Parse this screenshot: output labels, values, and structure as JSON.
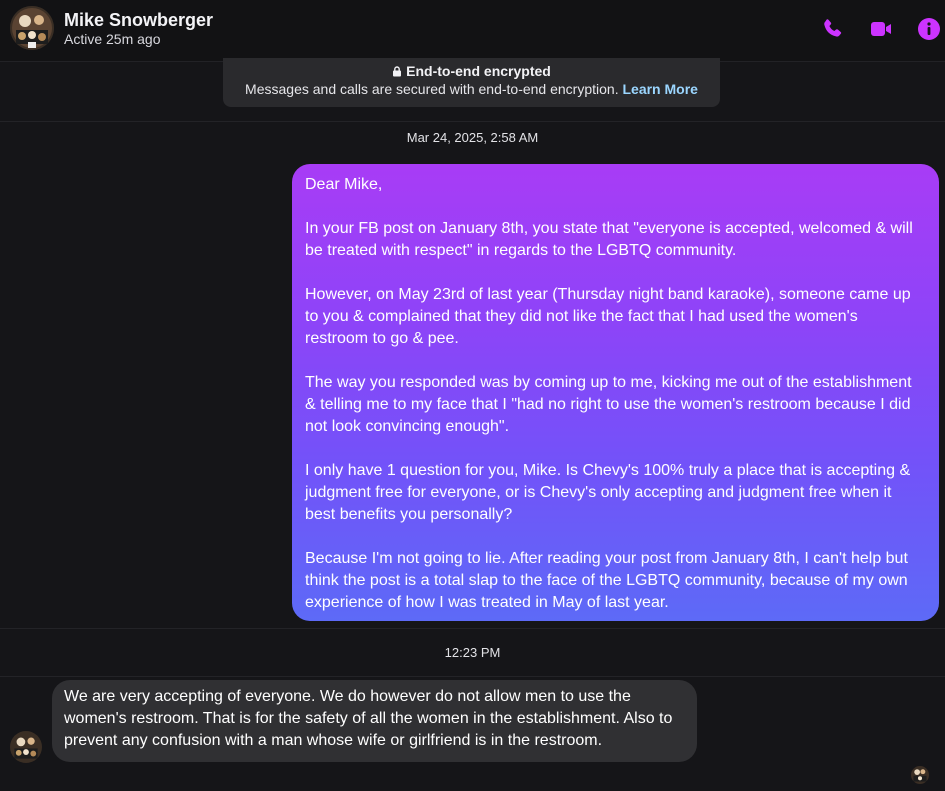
{
  "header": {
    "contact_name": "Mike Snowberger",
    "status": "Active 25m ago",
    "avatar_icon": "profile-photo",
    "actions": [
      {
        "name": "phone-icon"
      },
      {
        "name": "video-camera-icon"
      },
      {
        "name": "info-icon"
      }
    ],
    "accent_color": "#cc33ff"
  },
  "encryption": {
    "title": "End-to-end encrypted",
    "description": "Messages and calls are secured with end-to-end encryption.",
    "link": "Learn More"
  },
  "conversation": {
    "timestamp_1": "Mar 24, 2025, 2:58 AM",
    "outgoing_message": {
      "paragraphs": [
        "Dear Mike,",
        "In your FB post on January 8th, you state that \"everyone is accepted, welcomed & will be treated with respect\" in regards to the LGBTQ community.",
        "However, on May 23rd of last year (Thursday night band karaoke), someone came up to you & complained that they did not like the fact that I had used the women's restroom to go & pee.",
        "The way you responded was by coming up to me, kicking me out of the establishment & telling me to my face that I \"had no right to use the women's restroom because I did not look convincing enough\".",
        "I only have 1 question for you, Mike. Is Chevy's 100% truly a place that is accepting & judgment free for everyone, or is Chevy's only accepting and judgment free when it best benefits you personally?",
        "Because I'm not going to lie. After reading your post from January 8th, I can't help but think the post is a total slap to the face of the LGBTQ community, because of my own experience of how I was treated in May of last year."
      ],
      "gradient_colors": [
        "#a83cf6",
        "#5d6af7"
      ]
    },
    "timestamp_2": "12:23 PM",
    "incoming_message": {
      "text": "We are very accepting of everyone. We do however do not allow men to use the women's restroom. That is for the safety of all the women in the establishment. Also to prevent any confusion with a man whose wife or girlfriend is in the restroom."
    }
  }
}
